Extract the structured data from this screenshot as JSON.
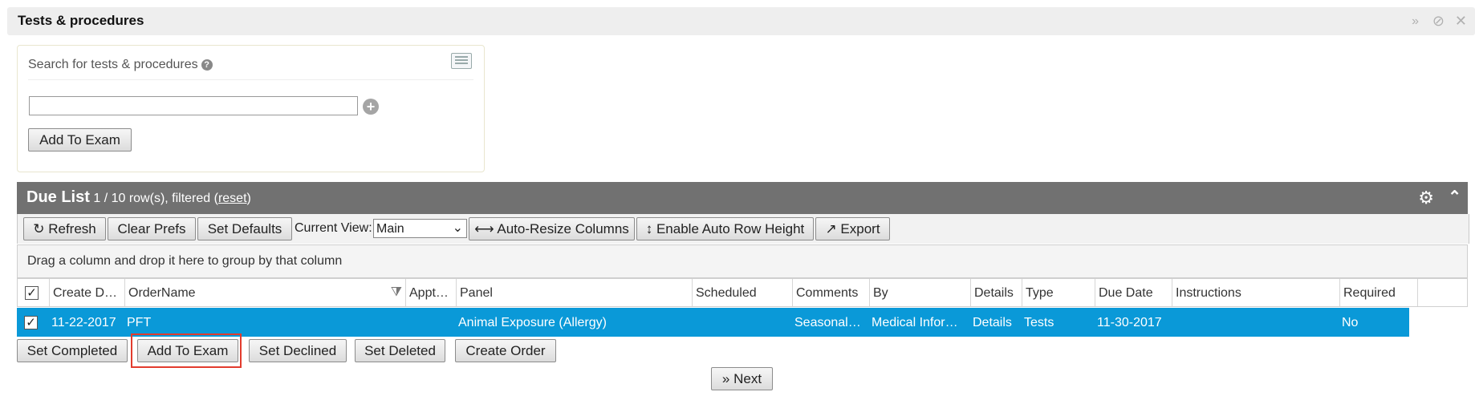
{
  "panel": {
    "title": "Tests & procedures",
    "controls": [
      "»",
      "⊘",
      "✕"
    ]
  },
  "search": {
    "label": "Search for tests & procedures",
    "input_value": "",
    "add_button": "Add To Exam"
  },
  "due_list": {
    "title": "Due List",
    "row_info_prefix": " 1 / 10 row(s), filtered (",
    "reset_link": "reset",
    "row_info_suffix": ")"
  },
  "toolbar": {
    "refresh": "Refresh",
    "clear_prefs": "Clear Prefs",
    "set_defaults": "Set Defaults",
    "current_view_label": "Current View:",
    "current_view_value": "Main",
    "auto_resize": "Auto-Resize Columns",
    "auto_row_height": "Enable Auto Row Height",
    "export": "Export"
  },
  "group_hint": "Drag a column and drop it here to group by that column",
  "columns": [
    "Create D…",
    "OrderName",
    "Appt…",
    "Panel",
    "Scheduled",
    "Comments",
    "By",
    "Details",
    "Type",
    "Due Date",
    "Instructions",
    "Required"
  ],
  "row": {
    "checked": true,
    "create_date": "11-22-2017",
    "order_name": "PFT",
    "appt": "",
    "panel": "Animal Exposure (Allergy)",
    "scheduled": "",
    "comments": "Seasonal…",
    "by": "Medical Infor…",
    "details": "Details",
    "type": "Tests",
    "due_date": "11-30-2017",
    "instructions": "",
    "required": "No"
  },
  "actions": {
    "set_completed": "Set Completed",
    "add_to_exam": "Add To Exam",
    "set_declined": "Set Declined",
    "set_deleted": "Set Deleted",
    "create_order": "Create Order",
    "next": "Next"
  },
  "colors": {
    "selected_row": "#0a99d8",
    "header_bar": "#717171",
    "highlight_box": "#e23c2e"
  }
}
